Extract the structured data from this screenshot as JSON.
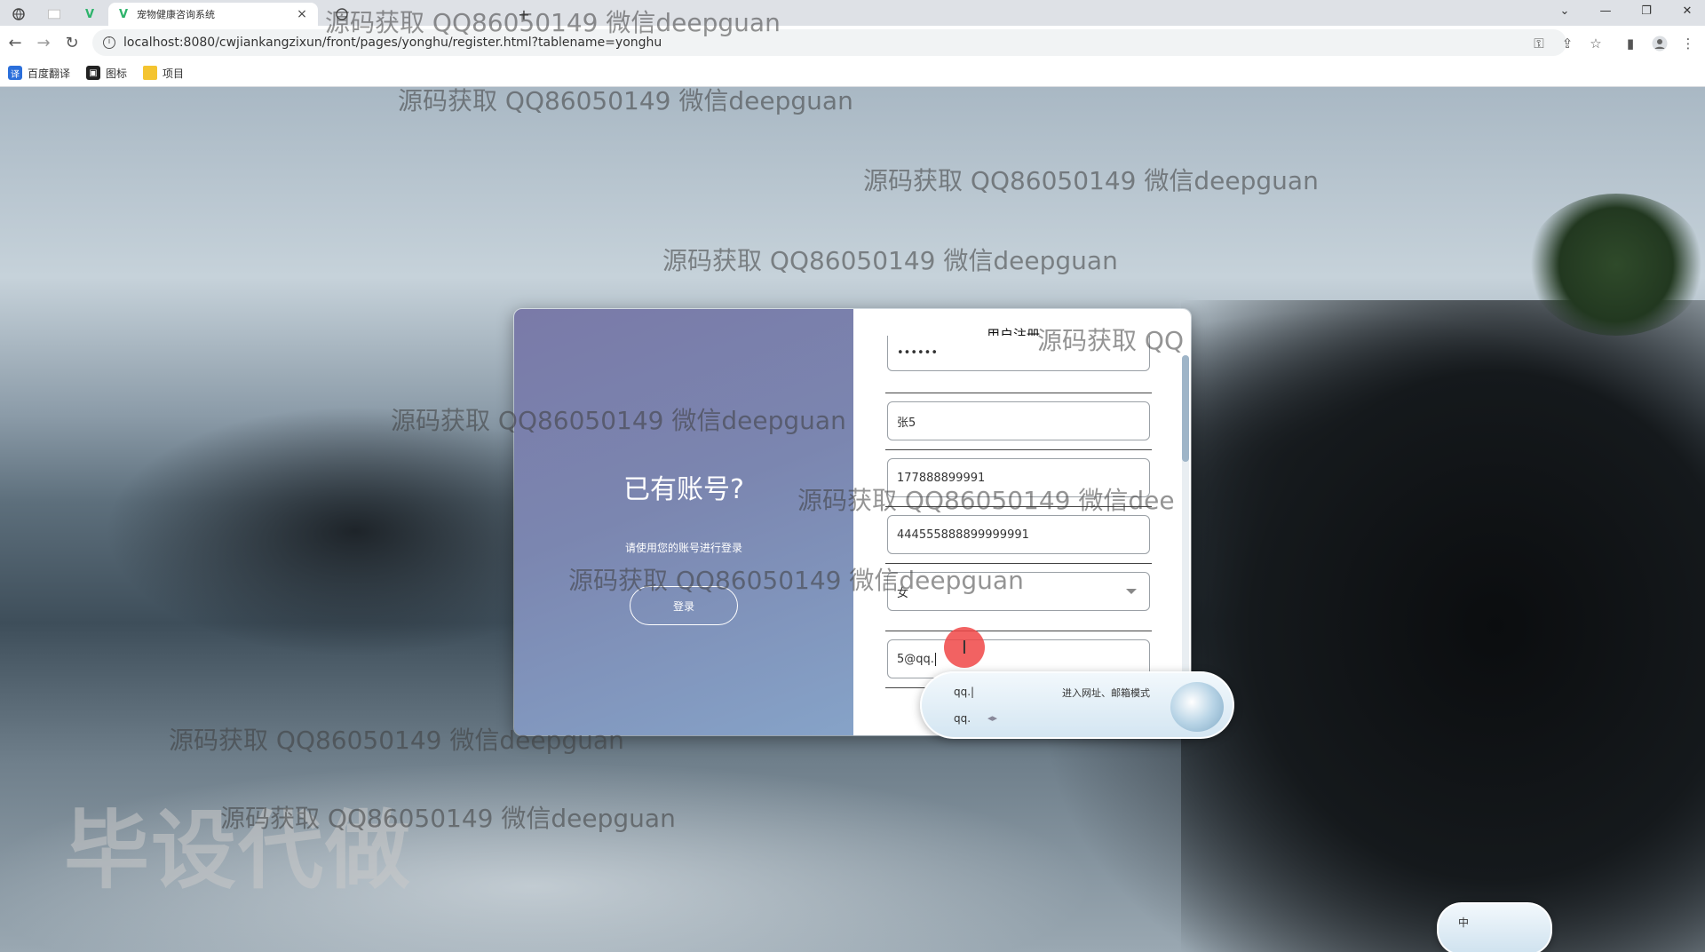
{
  "browser": {
    "tabs": [
      {
        "title": ""
      },
      {
        "title": ""
      },
      {
        "title": "宠物健康咨询系统",
        "active": true
      },
      {
        "title": ""
      },
      {
        "title": ""
      }
    ],
    "url": "localhost:8080/cwjiankangzixun/front/pages/yonghu/register.html?tablename=yonghu",
    "bookmarks": [
      {
        "label": "百度翻译"
      },
      {
        "label": "图标"
      },
      {
        "label": "项目"
      }
    ]
  },
  "register": {
    "panel_title": "已有账号?",
    "panel_subtitle": "请使用您的账号进行登录",
    "login_button": "登录",
    "form_title": "用户注册",
    "fields": {
      "password": "••••••",
      "name": "张5",
      "phone": "177888899991",
      "id_card": "444555888899999991",
      "gender": "女",
      "email": "5@qq."
    }
  },
  "ime": {
    "input": "qq.|",
    "hint": "进入网址、邮箱模式",
    "candidate": "qq.",
    "mode": "中"
  },
  "watermarks": {
    "text": "源码获取 QQ86050149 微信deepguan",
    "text_partial_a": "源码获取 QQ86050149 微信dee",
    "text_partial_b": "源码获取 QQ",
    "big": "毕设代做"
  },
  "colors": {
    "panel_gradient_start": "#7a7aa8",
    "panel_gradient_end": "#86a3c8",
    "cursor_highlight": "#f04646"
  }
}
